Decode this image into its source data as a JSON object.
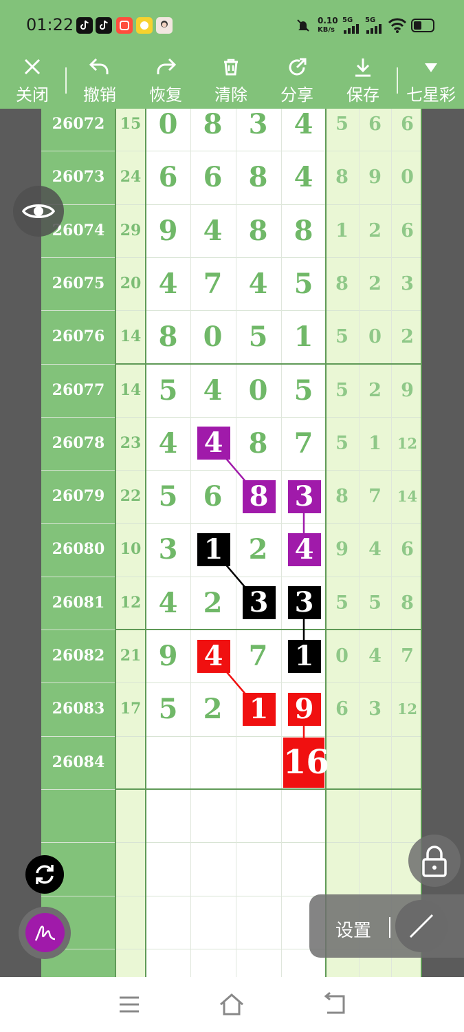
{
  "status_bar": {
    "time": "01:22",
    "net_speed_value": "0.10",
    "net_speed_unit": "KB/s",
    "sim1_label": "5G",
    "sim2_label": "5G",
    "icons": [
      "tiktok-icon",
      "tiktok-lite-icon",
      "kuaishou-icon",
      "hand-app-icon",
      "avatar-app-icon",
      "mute-bell-icon",
      "signal-icon",
      "wifi-icon",
      "battery-icon"
    ]
  },
  "toolbar": {
    "close_label": "关闭",
    "undo_label": "撤销",
    "redo_label": "恢复",
    "clear_label": "清除",
    "share_label": "分享",
    "save_label": "保存",
    "lottery_label": "七星彩"
  },
  "rows": [
    {
      "issue": "26072",
      "sum": "15",
      "digits": [
        "0",
        "8",
        "3",
        "4"
      ],
      "tail": [
        "5",
        "6",
        "6"
      ]
    },
    {
      "issue": "26073",
      "sum": "24",
      "digits": [
        "6",
        "6",
        "8",
        "4"
      ],
      "tail": [
        "8",
        "9",
        "0"
      ]
    },
    {
      "issue": "26074",
      "sum": "29",
      "digits": [
        "9",
        "4",
        "8",
        "8"
      ],
      "tail": [
        "1",
        "2",
        "6"
      ]
    },
    {
      "issue": "26075",
      "sum": "20",
      "digits": [
        "4",
        "7",
        "4",
        "5"
      ],
      "tail": [
        "8",
        "2",
        "3"
      ]
    },
    {
      "issue": "26076",
      "sum": "14",
      "digits": [
        "8",
        "0",
        "5",
        "1"
      ],
      "tail": [
        "5",
        "0",
        "2"
      ]
    },
    {
      "issue": "26077",
      "sum": "14",
      "digits": [
        "5",
        "4",
        "0",
        "5"
      ],
      "tail": [
        "5",
        "2",
        "9"
      ]
    },
    {
      "issue": "26078",
      "sum": "23",
      "digits": [
        "4",
        "4",
        "8",
        "7"
      ],
      "tail": [
        "5",
        "1",
        "12"
      ]
    },
    {
      "issue": "26079",
      "sum": "22",
      "digits": [
        "5",
        "6",
        "8",
        "3"
      ],
      "tail": [
        "8",
        "7",
        "14"
      ]
    },
    {
      "issue": "26080",
      "sum": "10",
      "digits": [
        "3",
        "1",
        "2",
        "4"
      ],
      "tail": [
        "9",
        "4",
        "6"
      ]
    },
    {
      "issue": "26081",
      "sum": "12",
      "digits": [
        "4",
        "2",
        "3",
        "3"
      ],
      "tail": [
        "5",
        "5",
        "8"
      ]
    },
    {
      "issue": "26082",
      "sum": "21",
      "digits": [
        "9",
        "4",
        "7",
        "1"
      ],
      "tail": [
        "0",
        "4",
        "7"
      ]
    },
    {
      "issue": "26083",
      "sum": "17",
      "digits": [
        "5",
        "2",
        "1",
        "9"
      ],
      "tail": [
        "6",
        "3",
        "12"
      ]
    },
    {
      "issue": "26084",
      "sum": "",
      "digits": [
        "",
        "",
        "",
        ""
      ],
      "tail": [
        "",
        "",
        ""
      ]
    }
  ],
  "highlights": [
    {
      "row": 6,
      "col": 1,
      "color": "purple"
    },
    {
      "row": 7,
      "col": 2,
      "color": "purple"
    },
    {
      "row": 7,
      "col": 3,
      "color": "purple"
    },
    {
      "row": 8,
      "col": 3,
      "color": "purple"
    },
    {
      "row": 8,
      "col": 1,
      "color": "black"
    },
    {
      "row": 9,
      "col": 2,
      "color": "black"
    },
    {
      "row": 9,
      "col": 3,
      "color": "black"
    },
    {
      "row": 10,
      "col": 3,
      "color": "black"
    },
    {
      "row": 10,
      "col": 1,
      "color": "red"
    },
    {
      "row": 11,
      "col": 2,
      "color": "red"
    },
    {
      "row": 11,
      "col": 3,
      "color": "red"
    }
  ],
  "prediction": {
    "issue": "26084",
    "value": "16",
    "color": "red"
  },
  "colors": {
    "purple": "#a01aaa",
    "black": "#000000",
    "red": "#f01010",
    "green": "#82c27a"
  },
  "floating": {
    "settings_label": "设置",
    "icons": [
      "eye-icon",
      "refresh-icon",
      "pen-icon",
      "lock-icon",
      "line-tool-icon"
    ]
  },
  "navbar": {
    "icons": [
      "menu-icon",
      "home-icon",
      "back-icon"
    ]
  }
}
